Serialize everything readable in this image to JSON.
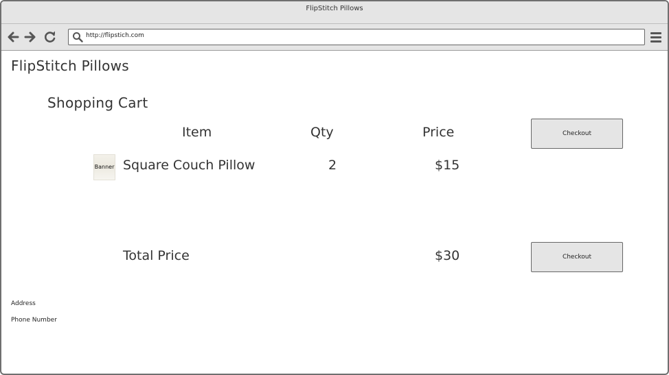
{
  "window": {
    "title": "FlipStitch Pillows"
  },
  "toolbar": {
    "url": "http://flipstich.com"
  },
  "site": {
    "brand": "FlipStitch Pillows"
  },
  "cart": {
    "title": "Shopping Cart",
    "columns": {
      "item": "Item",
      "qty": "Qty",
      "price": "Price"
    },
    "items": [
      {
        "thumbnail_text": "Banner",
        "name": "Square Couch Pillow",
        "qty": "2",
        "price": "$15"
      }
    ],
    "total_label": "Total Price",
    "total_value": "$30",
    "checkout_top": "Checkout",
    "checkout_bottom": "Checkout"
  },
  "footer": {
    "address": "Address",
    "phone": "Phone Number"
  },
  "icons": [
    "back-arrow-icon",
    "forward-arrow-icon",
    "reload-icon",
    "search-icon",
    "hamburger-menu-icon"
  ]
}
